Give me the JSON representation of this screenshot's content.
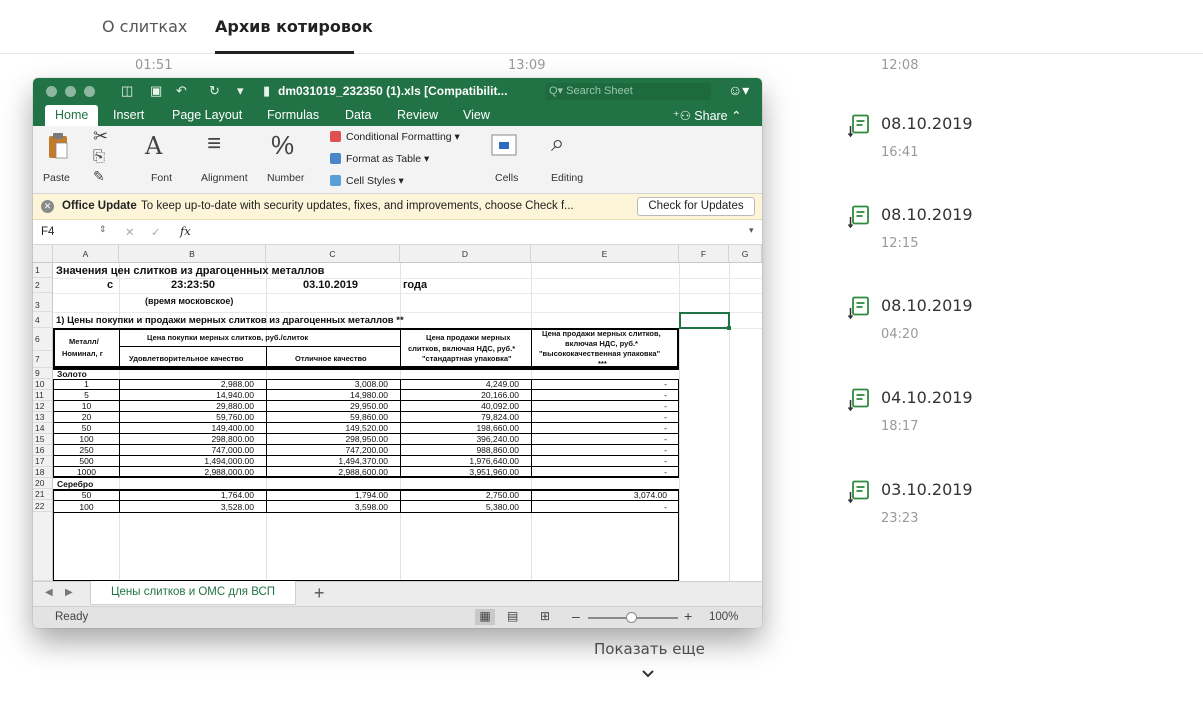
{
  "tabs": [
    "О слитках",
    "Архив котировок"
  ],
  "header_times": [
    "01:51",
    "13:09",
    "12:08"
  ],
  "archive": [
    {
      "date": "08.10.2019",
      "time": "16:41"
    },
    {
      "date": "08.10.2019",
      "time": "12:15"
    },
    {
      "date": "08.10.2019",
      "time": "04:20"
    },
    {
      "date": "04.10.2019",
      "time": "18:17"
    },
    {
      "date": "03.10.2019",
      "time": "23:23"
    }
  ],
  "show_more": "Показать еще",
  "colors": {
    "excel_green": "#217346",
    "update_bg": "#fcf5d8"
  },
  "excel": {
    "doc_title": "dm031019_232350 (1).xls  [Compatibilit...",
    "search_placeholder": "Search Sheet",
    "ribbon_tabs": [
      "Home",
      "Insert",
      "Page Layout",
      "Formulas",
      "Data",
      "Review",
      "View"
    ],
    "share_label": "Share",
    "ribbon": {
      "paste": "Paste",
      "font": "Font",
      "alignment": "Alignment",
      "number": "Number",
      "conditional_formatting": "Conditional Formatting",
      "format_as_table": "Format as Table",
      "cell_styles": "Cell Styles",
      "cells": "Cells",
      "editing": "Editing"
    },
    "update": {
      "title": "Office Update",
      "message": "To keep up-to-date with security updates, fixes, and improvements, choose Check f...",
      "button": "Check for Updates"
    },
    "name_box": "F4",
    "fx": "fx",
    "columns": [
      "A",
      "B",
      "C",
      "D",
      "E",
      "F",
      "G"
    ],
    "row_numbers": [
      "1",
      "2",
      "3",
      "4",
      "6",
      "7",
      "9",
      "10",
      "11",
      "12",
      "13",
      "14",
      "15",
      "16",
      "17",
      "18",
      "20",
      "21",
      "22"
    ],
    "sheet": {
      "title": "Значения цен слитков из драгоценных металлов",
      "r2_c": "с",
      "r2_time": "23:23:50",
      "r2_date": "03.10.2019",
      "r2_year": "года",
      "r3_note": "(время московское)",
      "r4_heading": "1) Цены покупки и продажи мерных слитков из драгоценных металлов **",
      "hdr_metal": "Металл/",
      "hdr_nominal": "Номинал, г",
      "hdr_buy": "Цена покупки мерных слитков, руб./слиток",
      "hdr_buy_sat": "Удовлетворительное качество",
      "hdr_buy_exc": "Отличное качество",
      "hdr_sell_std_1": "Цена продажи мерных",
      "hdr_sell_std_2": "слитков, включая НДС, руб.*",
      "hdr_sell_std_3": "\"стандартная упаковка\"",
      "hdr_sell_hq_1": "Цена продажи мерных слитков,",
      "hdr_sell_hq_2": "включая НДС, руб.*",
      "hdr_sell_hq_3": "\"высококачественная упаковка\"",
      "hdr_sell_hq_4": "***",
      "gold_label": "Золото",
      "silver_label": "Серебро",
      "gold_rows": [
        [
          "1",
          "2,988.00",
          "3,008.00",
          "4,249.00",
          "-"
        ],
        [
          "5",
          "14,940.00",
          "14,980.00",
          "20,166.00",
          "-"
        ],
        [
          "10",
          "29,880.00",
          "29,950.00",
          "40,092.00",
          "-"
        ],
        [
          "20",
          "59,760.00",
          "59,860.00",
          "79,824.00",
          "-"
        ],
        [
          "50",
          "149,400.00",
          "149,520.00",
          "198,660.00",
          "-"
        ],
        [
          "100",
          "298,800.00",
          "298,950.00",
          "396,240.00",
          "-"
        ],
        [
          "250",
          "747,000.00",
          "747,200.00",
          "988,860.00",
          "-"
        ],
        [
          "500",
          "1,494,000.00",
          "1,494,370.00",
          "1,976,640.00",
          "-"
        ],
        [
          "1000",
          "2,988,000.00",
          "2,988,600.00",
          "3,951,960.00",
          "-"
        ]
      ],
      "silver_rows": [
        [
          "50",
          "1,764.00",
          "1,794.00",
          "2,750.00",
          "3,074.00"
        ],
        [
          "100",
          "3,528.00",
          "3,598.00",
          "5,380.00",
          "-"
        ]
      ]
    },
    "sheet_tab": "Цены слитков и ОМС для ВСП",
    "status": "Ready",
    "zoom": "100%"
  }
}
